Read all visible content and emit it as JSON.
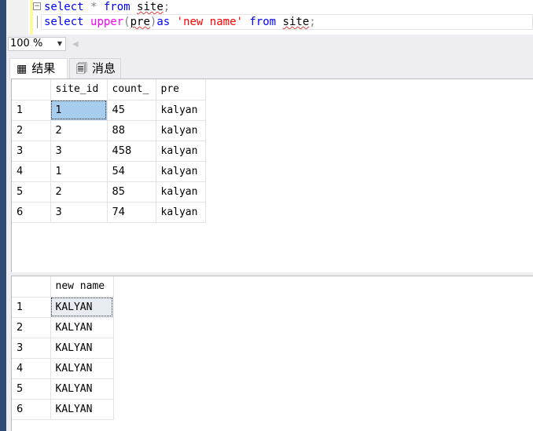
{
  "editor": {
    "line1": {
      "kw1": "select",
      "star": " * ",
      "kw2": "from",
      "tbl": "site",
      "end": ";"
    },
    "line2": {
      "kw1": "select",
      "fn": "upper",
      "p1": "(",
      "arg": "pre",
      "p2": ")",
      "as": "as",
      "alias": "'new name'",
      "kw2": "from",
      "tbl": "site",
      "end": ";"
    }
  },
  "toolbar": {
    "zoom": "100 %"
  },
  "tabs": [
    {
      "label": "结果",
      "icon": "grid-icon"
    },
    {
      "label": "消息",
      "icon": "messages-icon"
    }
  ],
  "result1": {
    "columns": [
      "site_id",
      "count_",
      "pre"
    ],
    "rows": [
      [
        "1",
        "1",
        "45",
        "kalyan"
      ],
      [
        "2",
        "2",
        "88",
        "kalyan"
      ],
      [
        "3",
        "3",
        "458",
        "kalyan"
      ],
      [
        "4",
        "1",
        "54",
        "kalyan"
      ],
      [
        "5",
        "2",
        "85",
        "kalyan"
      ],
      [
        "6",
        "3",
        "74",
        "kalyan"
      ]
    ]
  },
  "result2": {
    "columns": [
      "new name"
    ],
    "rows": [
      [
        "1",
        "KALYAN"
      ],
      [
        "2",
        "KALYAN"
      ],
      [
        "3",
        "KALYAN"
      ],
      [
        "4",
        "KALYAN"
      ],
      [
        "5",
        "KALYAN"
      ],
      [
        "6",
        "KALYAN"
      ]
    ]
  }
}
